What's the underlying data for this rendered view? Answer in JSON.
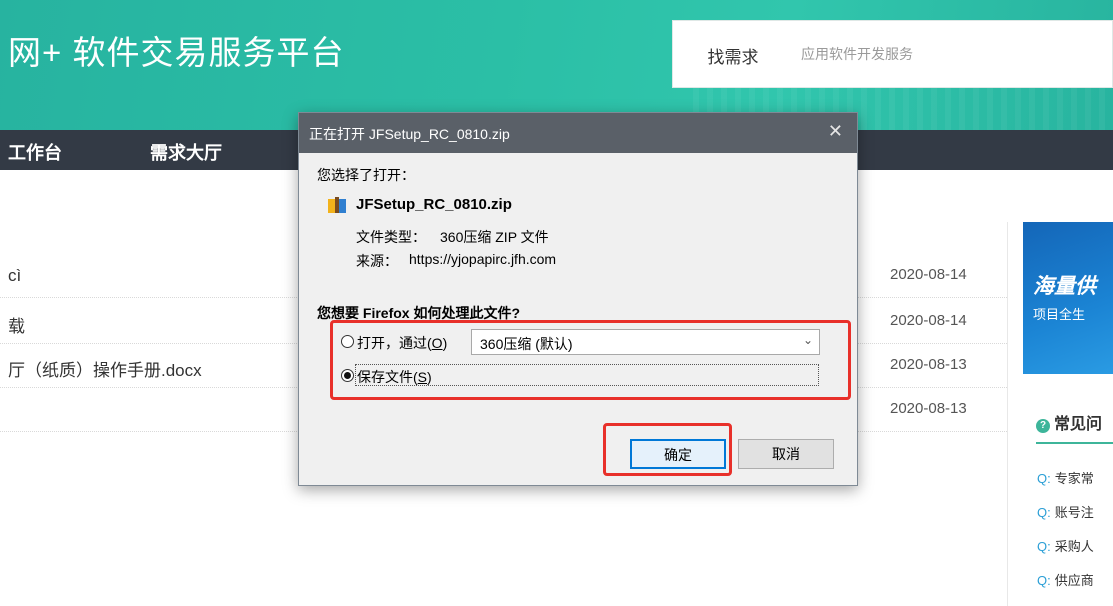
{
  "header": {
    "brand": "网+ 软件交易服务平台",
    "search_button": "找需求",
    "search_placeholder": "应用软件开发服务"
  },
  "nav": {
    "items": [
      "工作台",
      "需求大厅"
    ]
  },
  "list": {
    "rows": [
      {
        "title": "cì",
        "date": "2020-08-14"
      },
      {
        "title": "载",
        "date": "2020-08-14"
      },
      {
        "title": "厅（纸质）操作手册.docx",
        "date": "2020-08-13"
      },
      {
        "title": "",
        "date": "2020-08-13"
      }
    ]
  },
  "sidebar": {
    "banner_line1": "海量供",
    "banner_line2": "项目全生",
    "faq_title": "常见问",
    "faq_items": [
      {
        "q": "Q:",
        "text": "专家常"
      },
      {
        "q": "Q:",
        "text": "账号注"
      },
      {
        "q": "Q:",
        "text": "采购人"
      },
      {
        "q": "Q:",
        "text": "供应商"
      }
    ]
  },
  "dialog": {
    "title": "正在打开 JFSetup_RC_0810.zip",
    "close": "✕",
    "you_chose": "您选择了打开：",
    "file_name": "JFSetup_RC_0810.zip",
    "file_type_label": "文件类型：",
    "file_type_value": "360压缩 ZIP 文件",
    "source_label": "来源：",
    "source_value": "https://yjopapirc.jfh.com",
    "question": "您想要 Firefox 如何处理此文件?",
    "open_with_label": "打开，通过(",
    "open_with_key": "O",
    "open_with_suffix": ")",
    "open_with_app": "360压缩 (默认)",
    "save_label": "保存文件(",
    "save_key": "S",
    "save_suffix": ")",
    "ok": "确定",
    "cancel": "取消",
    "selected_option": "save"
  },
  "colors": {
    "header_teal": "#2bbfa6",
    "nav_dark": "#333a45",
    "dialog_titlebar": "#5a6068",
    "highlight_red": "#e8302a",
    "accent_blue": "#0078d7"
  }
}
